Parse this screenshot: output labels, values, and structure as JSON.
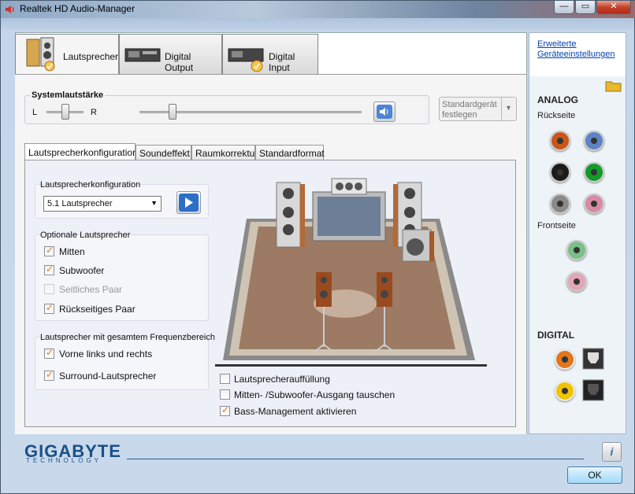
{
  "window": {
    "title": "Realtek HD Audio-Manager",
    "minimize": "—",
    "maximize": "▭",
    "close": "✕"
  },
  "main_tabs": [
    {
      "label": "Lautsprecher"
    },
    {
      "label": "Digital Output"
    },
    {
      "label": "Digital Input"
    }
  ],
  "volume": {
    "label": "Systemlautstärke",
    "left": "L",
    "right": "R",
    "balance_level": 0.5,
    "volume_level": 0.15
  },
  "default_device": {
    "label_line1": "Standardgerät",
    "label_line2": "festlegen"
  },
  "sub_tabs": [
    {
      "label": "Lautsprecherkonfiguration"
    },
    {
      "label": "Soundeffekt"
    },
    {
      "label": "Raumkorrektur"
    },
    {
      "label": "Standardformat"
    }
  ],
  "config": {
    "group_label": "Lautsprecherkonfiguration",
    "selected": "5.1 Lautsprecher"
  },
  "optional": {
    "group_label": "Optionale Lautsprecher",
    "items": [
      {
        "label": "Mitten"
      },
      {
        "label": "Subwoofer"
      },
      {
        "label": "Seitliches Paar"
      },
      {
        "label": "Rückseitiges Paar"
      }
    ]
  },
  "fullrange": {
    "group_label": "Lautsprecher mit gesamtem Frequenzbereich",
    "items": [
      {
        "label": "Vorne links und rechts"
      },
      {
        "label": "Surround-Lautsprecher"
      }
    ]
  },
  "bottom_options": [
    {
      "label": "Lautsprecherauffüllung"
    },
    {
      "label": "Mitten- /Subwoofer-Ausgang tauschen"
    },
    {
      "label": "Bass-Management aktivieren"
    }
  ],
  "sidebar": {
    "link_line1": "Erweiterte",
    "link_line2": "Geräteeinstellungen",
    "analog": "ANALOG",
    "back": "Rückseite",
    "front": "Frontseite",
    "digital": "DIGITAL"
  },
  "footer": {
    "brand": "GIGABYTE",
    "brand_sub": "TECHNOLOGY",
    "ok": "OK",
    "info": "i"
  },
  "colors": {
    "jack_orange": "#c8561c",
    "jack_blue": "#5d84c4",
    "jack_black": "#1b1b1b",
    "jack_green": "#139a2a",
    "jack_gray": "#8a8a8a",
    "jack_pink": "#d88aa5",
    "accent": "#e07c17"
  }
}
